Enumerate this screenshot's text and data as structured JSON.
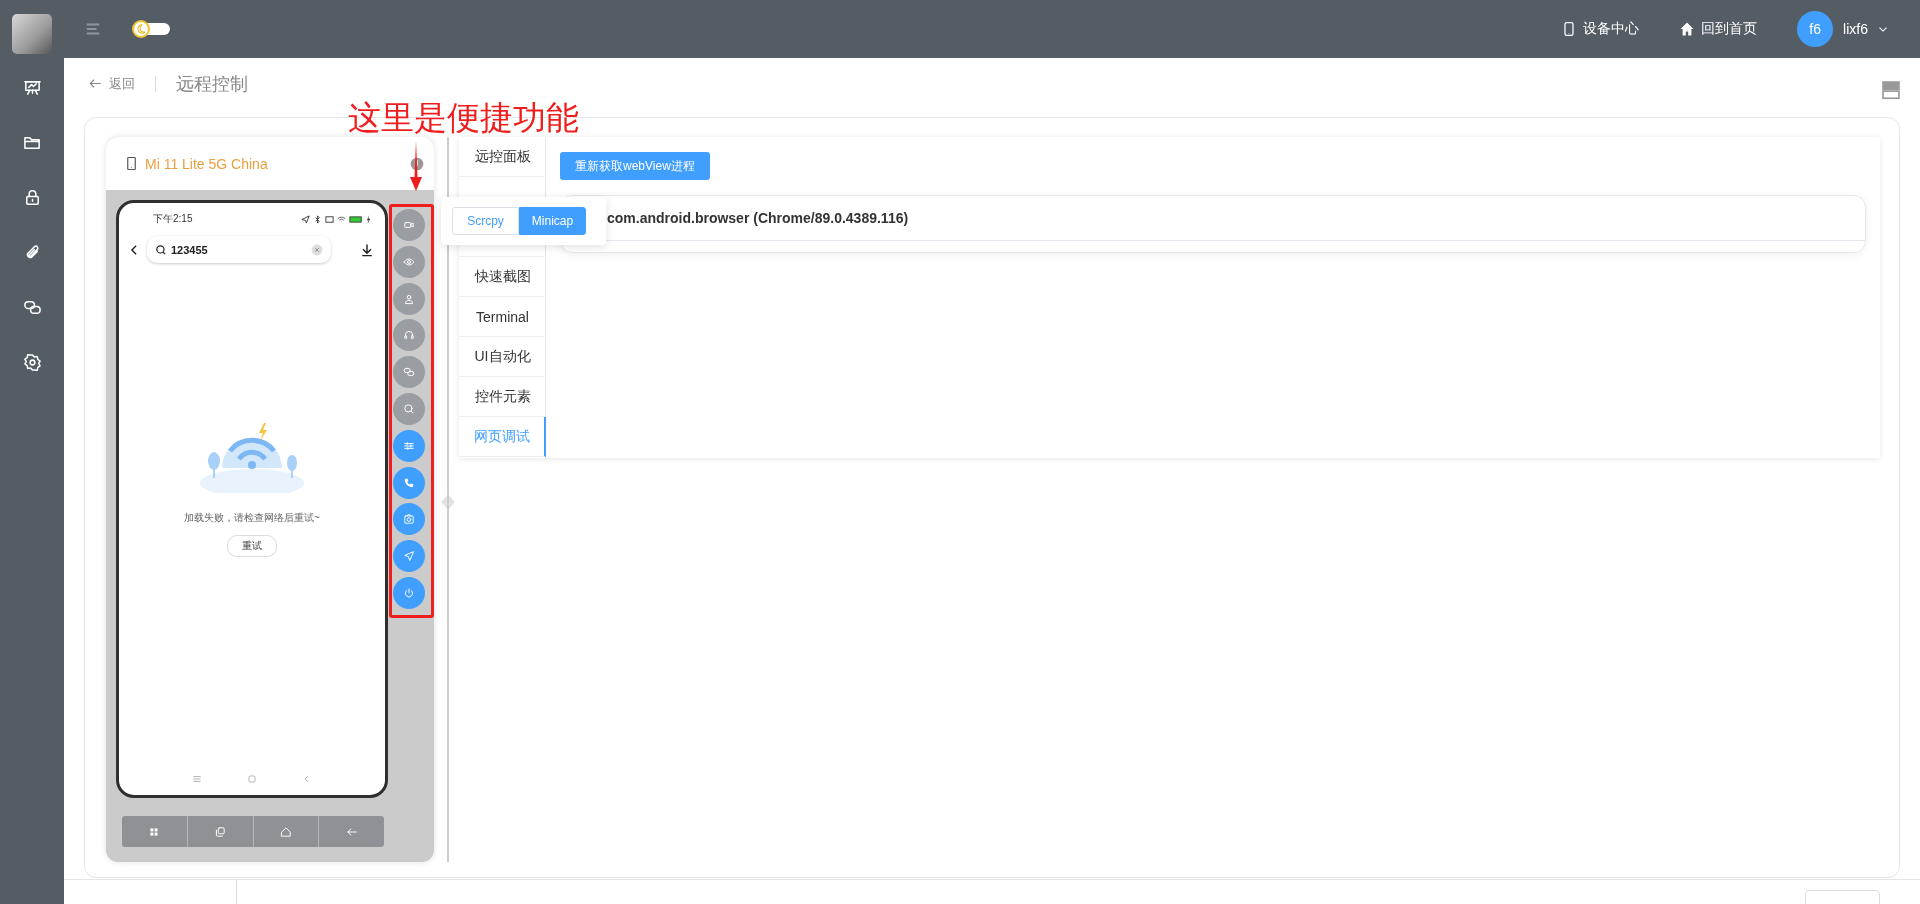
{
  "header": {
    "theme_switch": {
      "on": false
    },
    "links": [
      {
        "label": "设备中心"
      },
      {
        "label": "回到首页"
      }
    ],
    "user": {
      "avatar": "f6",
      "name": "lixf6"
    }
  },
  "breadcrumb": {
    "back": "返回",
    "title": "远程控制"
  },
  "annotation": "这里是便捷功能",
  "device": {
    "name": "Mi 11 Lite 5G China",
    "screen": {
      "time": "下午2:15",
      "search": "123455",
      "error": "加载失败，请检查网络后重试~",
      "retry": "重试"
    },
    "quick_buttons": [
      {
        "disabled": true
      },
      {
        "disabled": true
      },
      {
        "disabled": true
      },
      {
        "disabled": true
      },
      {
        "disabled": true
      },
      {
        "disabled": true
      },
      {
        "disabled": false
      },
      {
        "disabled": false
      },
      {
        "disabled": false
      },
      {
        "disabled": false
      },
      {
        "disabled": false
      }
    ]
  },
  "mirror_popup": {
    "options": [
      {
        "label": "Scrcpy",
        "selected": false
      },
      {
        "label": "Minicap",
        "selected": true
      }
    ]
  },
  "tabs": [
    {
      "label": "远控面板",
      "selected": false
    },
    {
      "label": "快速截图",
      "selected": false
    },
    {
      "label": "Terminal",
      "selected": false
    },
    {
      "label": "UI自动化",
      "selected": false
    },
    {
      "label": "控件元素",
      "selected": false
    },
    {
      "label": "网页调试",
      "selected": true
    }
  ],
  "webview": {
    "refresh_button": "重新获取webView进程",
    "processes": [
      "com.android.browser (Chrome/89.0.4389.116)"
    ]
  }
}
